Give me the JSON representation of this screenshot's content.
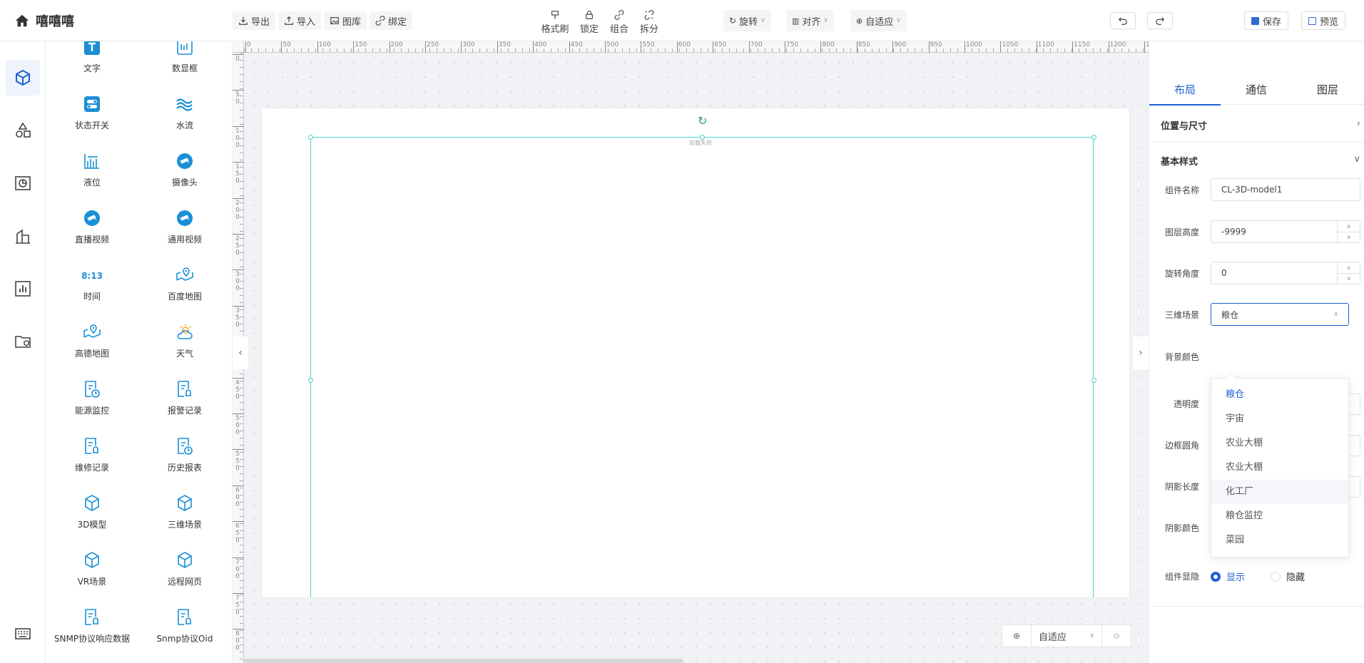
{
  "app": {
    "title": "嘻嘻嘻"
  },
  "toolbar": {
    "export": "导出",
    "import": "导入",
    "gallery": "图库",
    "bind": "绑定",
    "format_brush": "格式刷",
    "lock": "锁定",
    "group": "组合",
    "ungroup": "拆分",
    "rotate": "旋转",
    "align": "对齐",
    "fit": "自适应",
    "save": "保存",
    "preview": "预览"
  },
  "rail": {
    "items": [
      "cube-icon",
      "shapes-icon",
      "chart-icon",
      "building-icon",
      "bar-chart-icon",
      "folder-icon"
    ],
    "bottom": "keyboard-icon"
  },
  "components": [
    {
      "label": "文字",
      "icon": "text-icon"
    },
    {
      "label": "数显框",
      "icon": "number-display-icon"
    },
    {
      "label": "状态开关",
      "icon": "switch-icon"
    },
    {
      "label": "水流",
      "icon": "water-flow-icon"
    },
    {
      "label": "液位",
      "icon": "liquid-level-icon"
    },
    {
      "label": "摄像头",
      "icon": "camera-icon"
    },
    {
      "label": "直播视频",
      "icon": "live-video-icon"
    },
    {
      "label": "通用视频",
      "icon": "video-icon"
    },
    {
      "label": "时间",
      "icon": "time-icon",
      "text": "8:13"
    },
    {
      "label": "百度地图",
      "icon": "map-icon"
    },
    {
      "label": "高德地图",
      "icon": "map-icon"
    },
    {
      "label": "天气",
      "icon": "weather-icon"
    },
    {
      "label": "能源监控",
      "icon": "energy-doc-icon"
    },
    {
      "label": "报警记录",
      "icon": "alarm-doc-icon"
    },
    {
      "label": "维修记录",
      "icon": "repair-doc-icon"
    },
    {
      "label": "历史报表",
      "icon": "history-doc-icon"
    },
    {
      "label": "3D模型",
      "icon": "model-3d-icon"
    },
    {
      "label": "三维场景",
      "icon": "scene-3d-icon"
    },
    {
      "label": "VR场景",
      "icon": "vr-icon"
    },
    {
      "label": "远程网页",
      "icon": "webpage-icon"
    },
    {
      "label": "SNMP协议响应数据",
      "icon": "snmp-doc-icon"
    },
    {
      "label": "Snmp协议Oid",
      "icon": "snmp-oid-icon"
    }
  ],
  "ruler": {
    "top": [
      "0",
      "50",
      "100",
      "150",
      "200",
      "250",
      "300",
      "350",
      "400",
      "450",
      "500",
      "550",
      "600",
      "650",
      "700",
      "750",
      "800",
      "850",
      "900",
      "950",
      "1000",
      "1050",
      "1100",
      "1150",
      "1200",
      "12"
    ],
    "left": [
      "0",
      "5\n0",
      "1\n0\n0",
      "1\n5\n0",
      "2\n0\n0",
      "2\n5\n0",
      "3\n0\n0",
      "3\n5\n0",
      "4\n0\n0",
      "4\n5\n0",
      "5\n0\n0",
      "5\n5\n0",
      "6\n0\n0",
      "6\n5\n0",
      "7\n0\n0",
      "7\n5\n0",
      "8\n0\n0"
    ]
  },
  "canvas": {
    "selection_label": "加载失败",
    "zoom_value": "自适应"
  },
  "right": {
    "tabs": [
      "布局",
      "通信",
      "图层"
    ],
    "active_tab": 0,
    "section_position": "位置与尺寸",
    "section_style": "基本样式",
    "fields": {
      "name_label": "组件名称",
      "name_value": "CL-3D-model1",
      "zindex_label": "图层高度",
      "zindex_value": "-9999",
      "rotate_label": "旋转角度",
      "rotate_value": "0",
      "scene_label": "三维场景",
      "scene_value": "粮仓",
      "bg_label": "背景颜色",
      "opacity_label": "透明度",
      "radius_label": "边框圆角",
      "shadow_len_label": "阴影长度",
      "shadow_color_label": "阴影颜色",
      "visibility_label": "组件显隐",
      "show": "显示",
      "hide": "隐藏"
    },
    "scene_options": [
      "粮仓",
      "宇宙",
      "农业大棚",
      "农业大棚",
      "化工厂",
      "粮仓监控",
      "菜园"
    ]
  },
  "colors": {
    "accent": "#1f5fd1",
    "icon": "#1a8fd6",
    "selection": "#4fd1c5"
  }
}
